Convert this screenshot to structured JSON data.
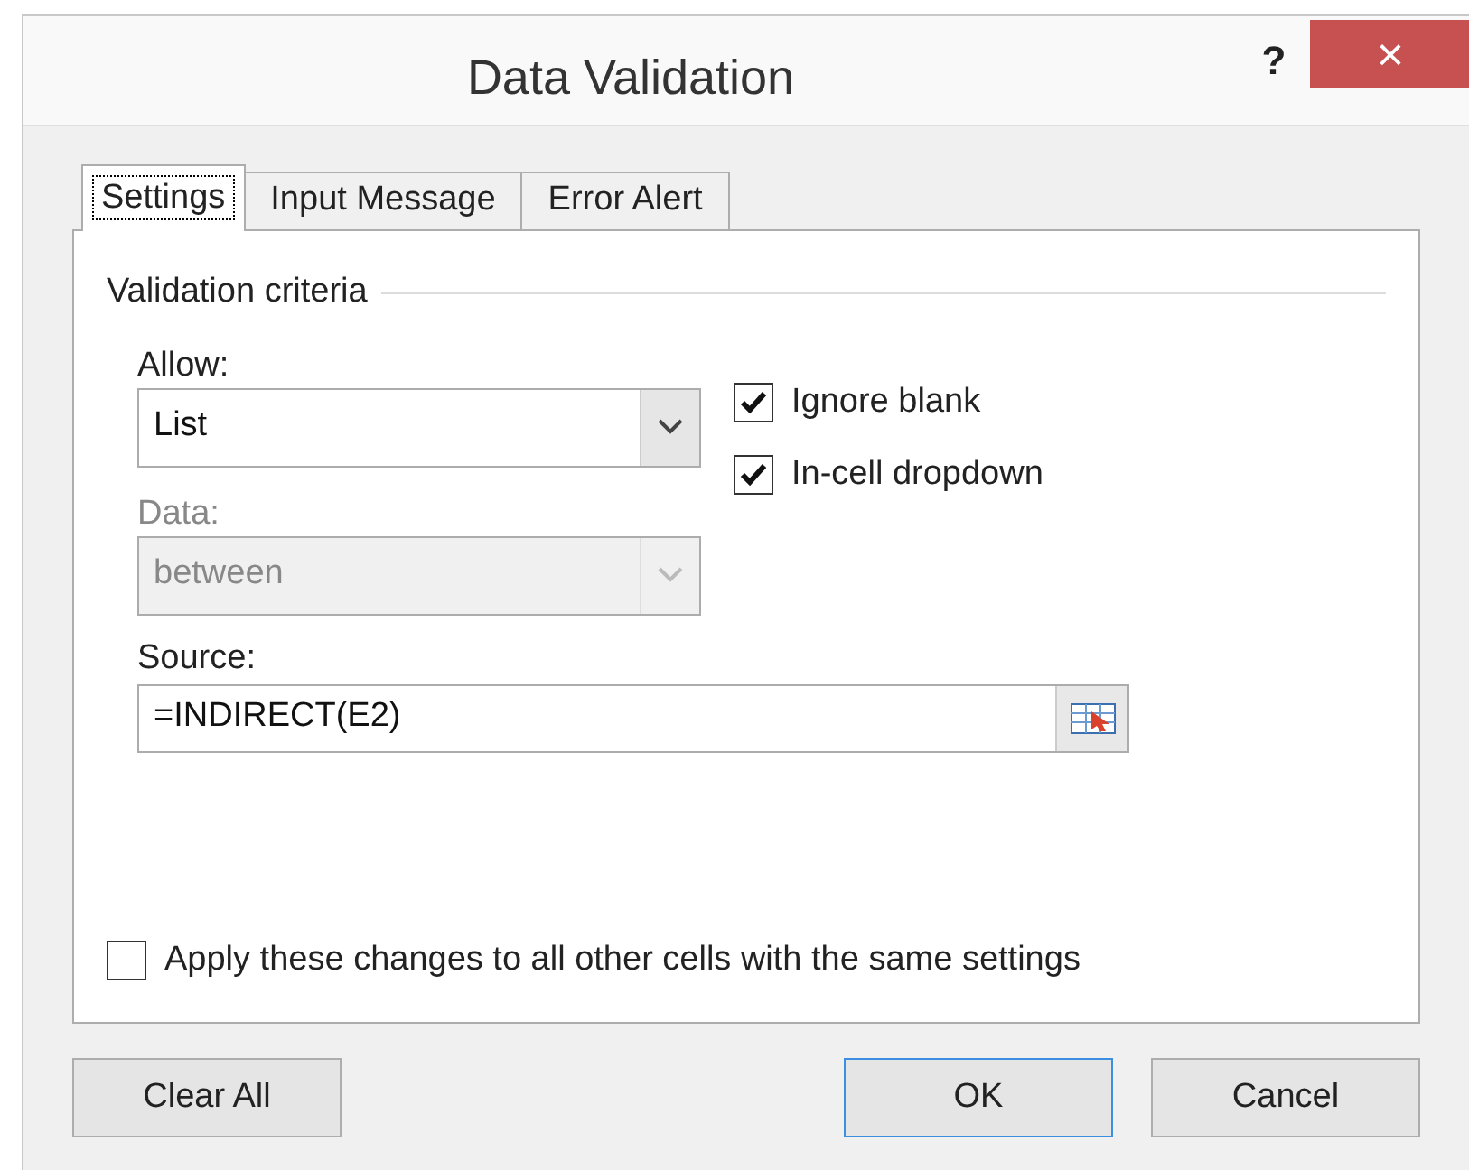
{
  "window": {
    "title": "Data Validation",
    "help": "?",
    "close": "×"
  },
  "tabs": [
    {
      "label": "Settings",
      "selected": true
    },
    {
      "label": "Input Message",
      "selected": false
    },
    {
      "label": "Error Alert",
      "selected": false
    }
  ],
  "group_title": "Validation criteria",
  "allow": {
    "label": "Allow:",
    "value": "List",
    "disabled": false
  },
  "data": {
    "label": "Data:",
    "value": "between",
    "disabled": true
  },
  "checkboxes": [
    {
      "label": "Ignore blank",
      "checked": true
    },
    {
      "label": "In-cell dropdown",
      "checked": true
    }
  ],
  "source": {
    "label": "Source:",
    "value": "=INDIRECT(E2)"
  },
  "apply_all": {
    "label": "Apply these changes to all other cells with the same settings",
    "checked": false
  },
  "buttons": [
    {
      "label": "Clear All",
      "default": false
    },
    {
      "label": "OK",
      "default": true
    },
    {
      "label": "Cancel",
      "default": false
    }
  ]
}
